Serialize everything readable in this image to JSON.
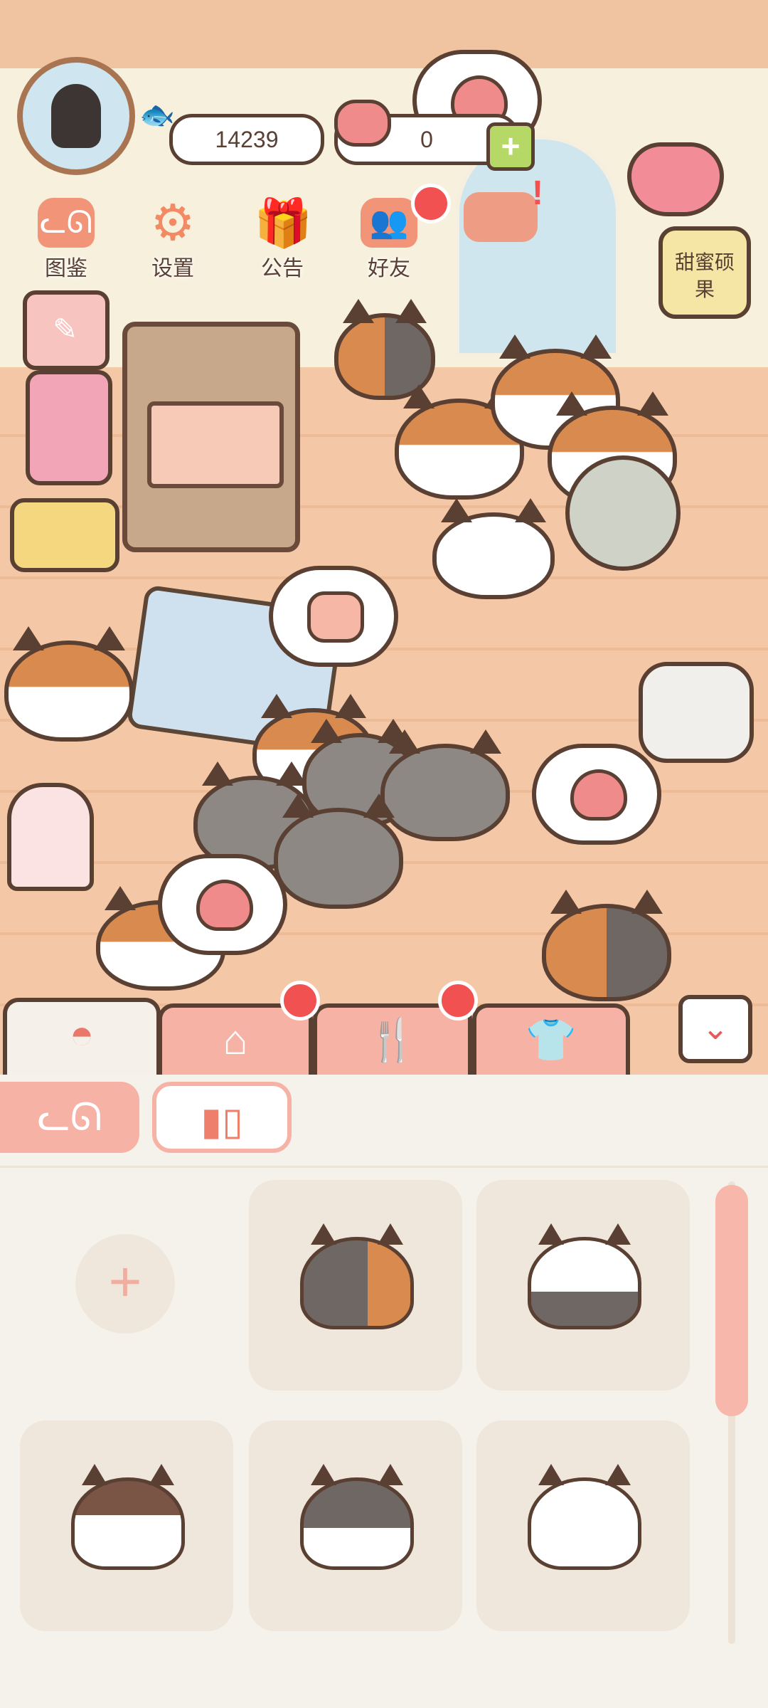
{
  "hud": {
    "fish_coins": "14239",
    "hearts": "0",
    "menu": [
      {
        "label": "图鉴",
        "icon": "cat-head-icon"
      },
      {
        "label": "设置",
        "icon": "gear-icon"
      },
      {
        "label": "公告",
        "icon": "gift-icon"
      },
      {
        "label": "好友",
        "icon": "friends-icon"
      }
    ],
    "honey_label": "甜蜜硕果"
  },
  "tabs": [
    "cat-bowl-tab",
    "house-tab",
    "food-tab",
    "clothes-tab"
  ],
  "cat_slots": [
    {
      "icon": "add-slot-icon"
    },
    {
      "icon": "calico-dark-cat-icon"
    },
    {
      "icon": "white-calico-cat-icon"
    },
    {
      "icon": "brown-white-cat-icon"
    },
    {
      "icon": "gray-white-cat-icon"
    },
    {
      "icon": "white-orange-cat-icon"
    }
  ],
  "colors": {
    "accent": "#f6b3a5",
    "outline": "#5a3f33",
    "panel": "#f5f2ec",
    "notify": "#f25152"
  },
  "add_label": "+"
}
